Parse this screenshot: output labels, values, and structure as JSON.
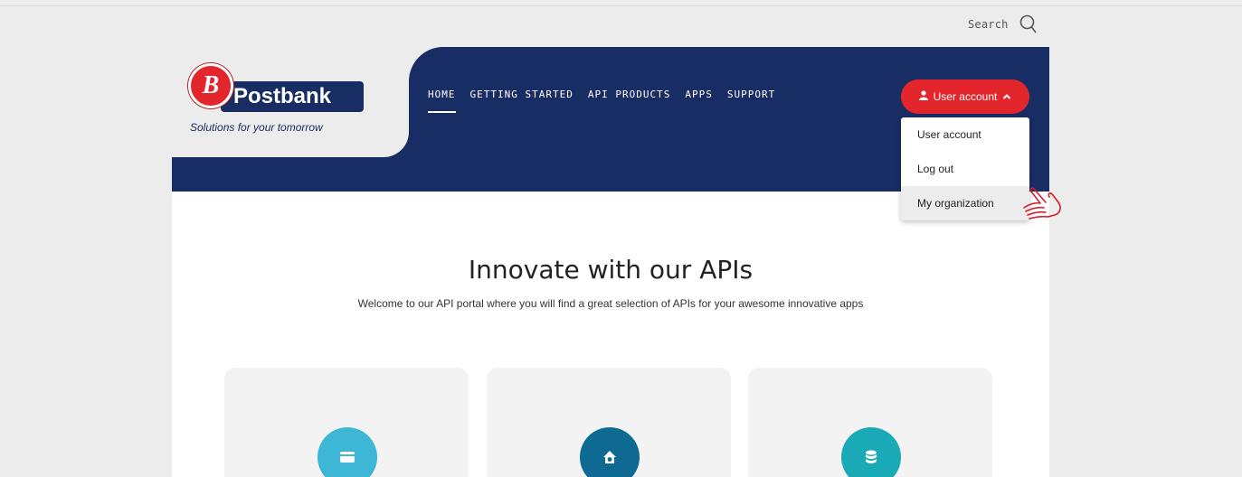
{
  "search": {
    "label": "Search",
    "icon": "search-icon"
  },
  "brand": {
    "mark": "B",
    "name": "Postbank",
    "tagline": "Solutions for your tomorrow",
    "red": "#e3262b",
    "navy": "#182d64"
  },
  "nav": {
    "items": [
      {
        "label": "HOME",
        "active": true
      },
      {
        "label": "GETTING STARTED"
      },
      {
        "label": "API PRODUCTS"
      },
      {
        "label": "APPS"
      },
      {
        "label": "SUPPORT"
      }
    ]
  },
  "user_menu": {
    "button_label": "User account",
    "icon": "user-icon",
    "expanded": true,
    "items": [
      {
        "label": "User account"
      },
      {
        "label": "Log out"
      },
      {
        "label": "My organization",
        "hovered": true
      }
    ]
  },
  "hero": {
    "title": "Innovate with our APIs",
    "subtitle": "Welcome to our API portal where you will find a great selection of APIs for your awesome innovative apps"
  },
  "cards": [
    {
      "icon": "credit-card-icon",
      "color": "#3eb6d5"
    },
    {
      "icon": "house-dollar-icon",
      "color": "#0e6a93"
    },
    {
      "icon": "coin-stack-icon",
      "color": "#1aa9b6"
    }
  ]
}
